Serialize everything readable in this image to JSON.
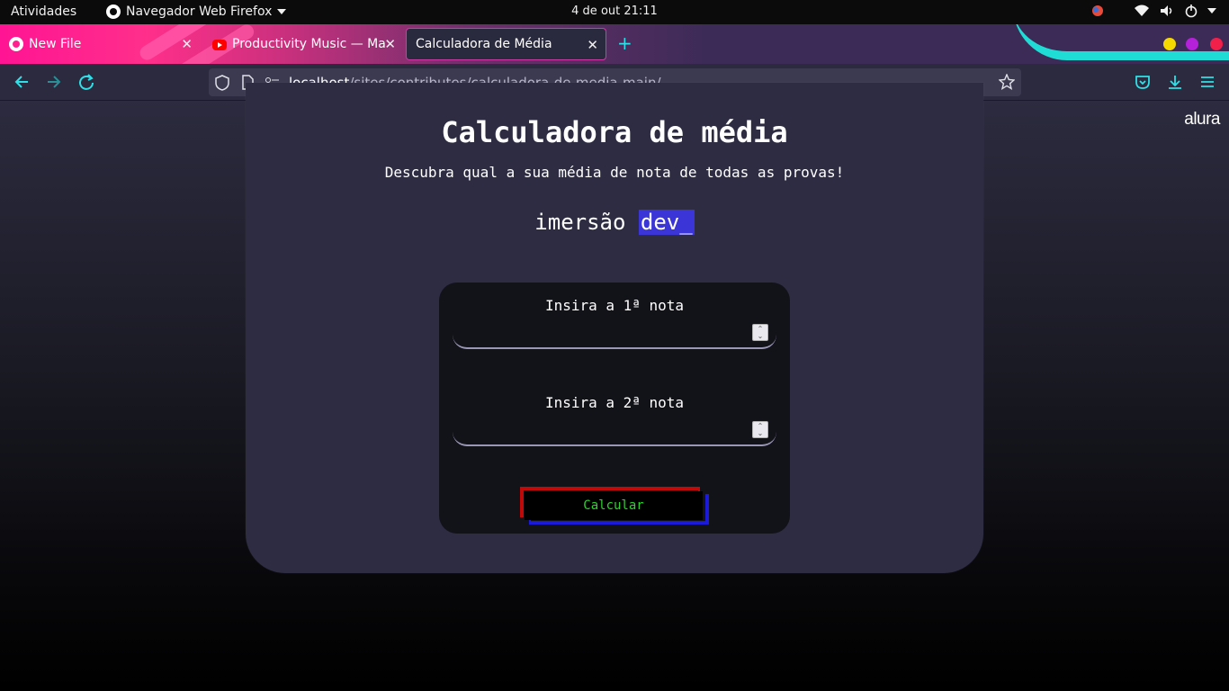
{
  "os_bar": {
    "activities": "Atividades",
    "app_name": "Navegador Web Firefox",
    "clock": "4 de out  21:11"
  },
  "tabs": [
    {
      "label": "New File",
      "favicon": "github-icon"
    },
    {
      "label": "Productivity Music — Ma",
      "favicon": "youtube-icon"
    },
    {
      "label": "Calculadora de Média",
      "favicon": "none",
      "active": true
    }
  ],
  "navbar": {
    "url_host": "localhost",
    "url_path": "/sites/contributes/calculadora-de-media-main/"
  },
  "page": {
    "logo": "alura",
    "title": "Calculadora de média",
    "subtitle": "Descubra qual a sua média de nota de todas as provas!",
    "brand_prefix": "imersão",
    "brand_highlight": "dev_",
    "field1_label": "Insira a 1ª nota",
    "field2_label": "Insira a 2ª nota",
    "field1_value": "",
    "field2_value": "",
    "button_label": "Calcular"
  },
  "colors": {
    "accent_cyan": "#30e0e8",
    "highlight": "#3b35d8",
    "button_text": "#2fd12f",
    "button_red": "#c00a0a",
    "button_blue": "#1a1ad8"
  }
}
